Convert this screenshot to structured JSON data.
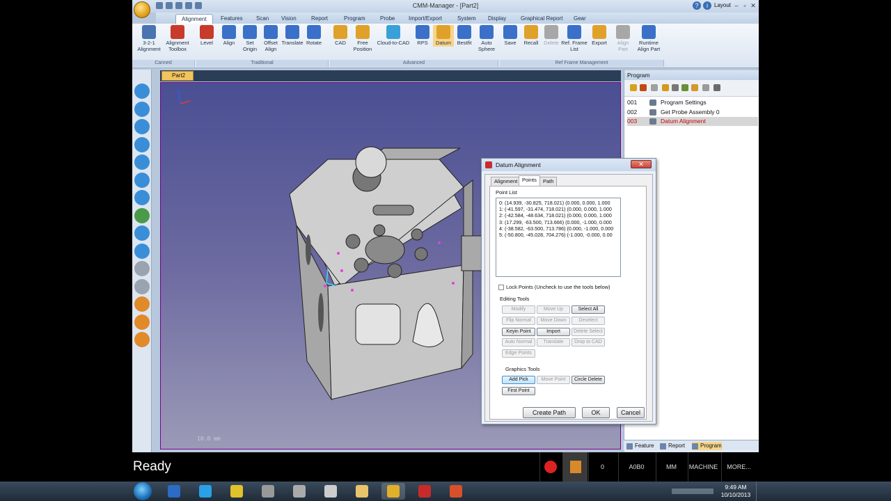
{
  "app": {
    "title": "CMM-Manager - [Part2]",
    "layout_label": "Layout"
  },
  "menu_tabs": [
    "Alignment",
    "Features",
    "Scan",
    "Vision",
    "Report",
    "Program",
    "Probe",
    "Import/Export",
    "System",
    "Display",
    "Graphical Report",
    "Gear"
  ],
  "ribbon": {
    "buttons": [
      {
        "label": "3-2-1 Alignment",
        "enabled": true
      },
      {
        "label": "Alignment Toolbox",
        "enabled": true
      },
      {
        "label": "Level",
        "enabled": true
      },
      {
        "label": "Align",
        "enabled": true
      },
      {
        "label": "Set Origin",
        "enabled": true
      },
      {
        "label": "Offset Align",
        "enabled": true
      },
      {
        "label": "Translate",
        "enabled": true
      },
      {
        "label": "Rotate",
        "enabled": true
      },
      {
        "label": "CAD",
        "enabled": true
      },
      {
        "label": "Free Position",
        "enabled": true
      },
      {
        "label": "Cloud-to-CAD",
        "enabled": true
      },
      {
        "label": "RPS",
        "enabled": true
      },
      {
        "label": "Datum",
        "enabled": true
      },
      {
        "label": "Bestfit",
        "enabled": true
      },
      {
        "label": "Auto Sphere",
        "enabled": true
      },
      {
        "label": "Save",
        "enabled": true
      },
      {
        "label": "Recall",
        "enabled": true
      },
      {
        "label": "Delete",
        "enabled": false
      },
      {
        "label": "Ref. Frame List",
        "enabled": true
      },
      {
        "label": "Export",
        "enabled": true
      },
      {
        "label": "Align Part",
        "enabled": false
      },
      {
        "label": "Runtime Align Part",
        "enabled": true
      }
    ],
    "groups": [
      "Canned",
      "Traditional",
      "Advanced",
      "Ref Frame Management"
    ]
  },
  "document": {
    "tab": "Part2",
    "scale_label": "10.0 mm"
  },
  "program_panel": {
    "title": "Program",
    "rows": [
      {
        "num": "001",
        "label": "Program Settings"
      },
      {
        "num": "002",
        "label": "Get Probe Assembly 0"
      },
      {
        "num": "003",
        "label": "Datum Alignment"
      }
    ],
    "bottom_tabs": [
      "Feature",
      "Report",
      "Program"
    ]
  },
  "dialog": {
    "title": "Datum Alignment",
    "tabs": [
      "Alignment",
      "Points",
      "Path"
    ],
    "point_list_label": "Point List",
    "points": [
      "0: (14.939, -30.825, 718.021)   (0.000, 0.000, 1.000",
      "1: (-41.597, -31.474, 718.021)   (0.000, 0.000, 1.000",
      "2: (-42.584, -48.634, 718.021)   (0.000, 0.000, 1.000",
      "3: (17.299, -63.500, 713.666)   (0.000, -1.000, 0.000",
      "4: (-38.582, -63.500, 713.786)   (0.000, -1.000, 0.000",
      "5: (-50.800, -45.028, 704.276)   (-1.000, -0.000, 0.00"
    ],
    "lock_points": {
      "label": "Lock Points",
      "hint": "(Uncheck to use the tools below)"
    },
    "editing_tools_label": "Editing Tools",
    "editing_tools": [
      {
        "label": "Modify",
        "enabled": false
      },
      {
        "label": "Move Up",
        "enabled": false
      },
      {
        "label": "Select All",
        "enabled": true
      },
      {
        "label": "Flip Normal",
        "enabled": false
      },
      {
        "label": "Move Down",
        "enabled": false
      },
      {
        "label": "Deselect",
        "enabled": false
      },
      {
        "label": "Keyin Point",
        "enabled": true
      },
      {
        "label": "Import",
        "enabled": true
      },
      {
        "label": "Delete Select",
        "enabled": false
      },
      {
        "label": "Auto Normal",
        "enabled": false
      },
      {
        "label": "Translate",
        "enabled": false
      },
      {
        "label": "Drop to CAD",
        "enabled": false
      },
      {
        "label": "Edge Points",
        "enabled": false
      }
    ],
    "graphics_tools_label": "Graphics Tools",
    "graphics_tools": [
      {
        "label": "Add Pick",
        "enabled": true
      },
      {
        "label": "Move Point",
        "enabled": false
      },
      {
        "label": "Circle Delete",
        "enabled": true
      },
      {
        "label": "First Point",
        "enabled": true
      }
    ],
    "footer": [
      "Create Path",
      "OK",
      "Cancel"
    ]
  },
  "statusbar": {
    "ready": "Ready",
    "counter": "0",
    "code": "A0B0",
    "units": "MM",
    "mode": "MACHINE",
    "more": "MORE..."
  },
  "clock": {
    "time": "9:49 AM",
    "date": "10/10/2013"
  }
}
